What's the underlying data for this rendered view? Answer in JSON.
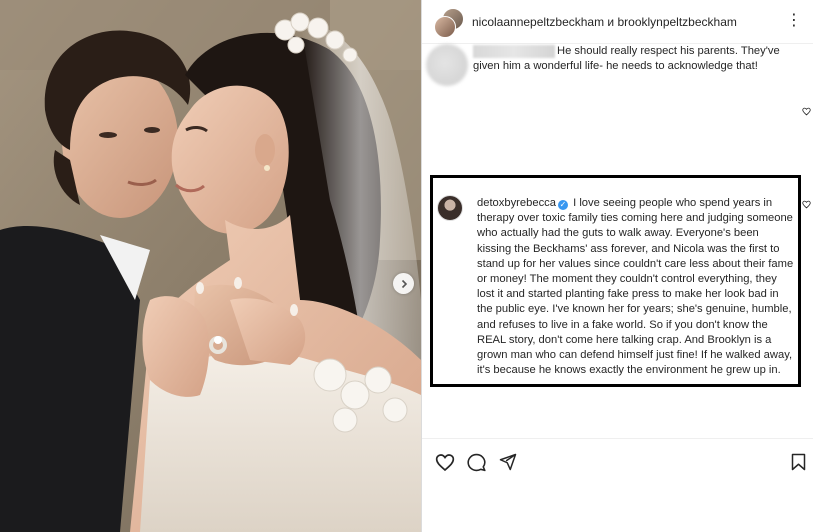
{
  "header": {
    "user1": "nicolaannepeltzbeckham",
    "connector": " и ",
    "user2": "brooklynpeltzbeckham",
    "more_label": "⋮"
  },
  "comments": [
    {
      "username_redacted": true,
      "text": "He should really respect his parents. They've given him a wonderful life- he needs to acknowledge that!"
    },
    {
      "username": "detoxbyrebecca",
      "verified": true,
      "text": "I love seeing people who spend years in therapy over toxic family ties coming here and judging someone who actually had the guts to walk away. Everyone's been kissing the Beckhams' ass forever, and Nicola was the first to stand up for her values since couldn't care less about their fame or money! The moment they couldn't control everything, they lost it and started planting fake press to make her look bad in the public eye. I've known her for years; she's genuine, humble, and refuses to live in a fake world. So if you don't know the REAL story, don't come here talking crap. And Brooklyn is a grown man who can defend himself just fine! If he walked away, it's because he knows exactly the environment he grew up in."
    }
  ],
  "icons": {
    "like": "heart-icon",
    "comment": "comment-icon",
    "share": "share-icon",
    "save": "bookmark-icon",
    "next": "chevron-right-icon"
  },
  "colors": {
    "text": "#262626",
    "border": "#dbdbdb",
    "verified": "#3897f0",
    "highlight": "#000000"
  }
}
